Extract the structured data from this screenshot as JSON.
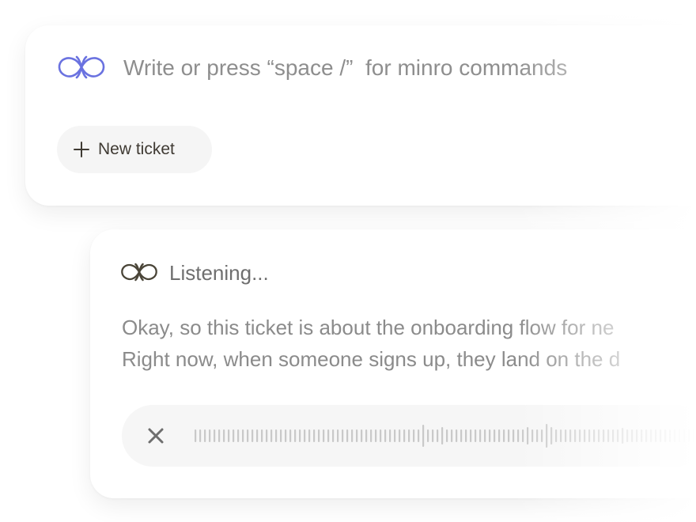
{
  "composer": {
    "logo": "infinity-logo-icon",
    "input_placeholder": "Write or press “space /”  for minro commands",
    "new_ticket_label": "New ticket",
    "new_ticket_icon": "plus-icon"
  },
  "listening": {
    "logo": "infinity-logo-icon",
    "status": "Listening...",
    "transcript": [
      "Okay, so this ticket is about the onboarding flow for ne",
      "Right now, when someone signs up, they land on the d"
    ],
    "close_icon": "close-icon",
    "waveform_icon": "audio-waveform"
  },
  "colors": {
    "brand_logo": "#6a72e0",
    "listening_logo": "#4a4538",
    "text_muted": "#8a8a8a",
    "button_bg": "#f5f5f5"
  }
}
